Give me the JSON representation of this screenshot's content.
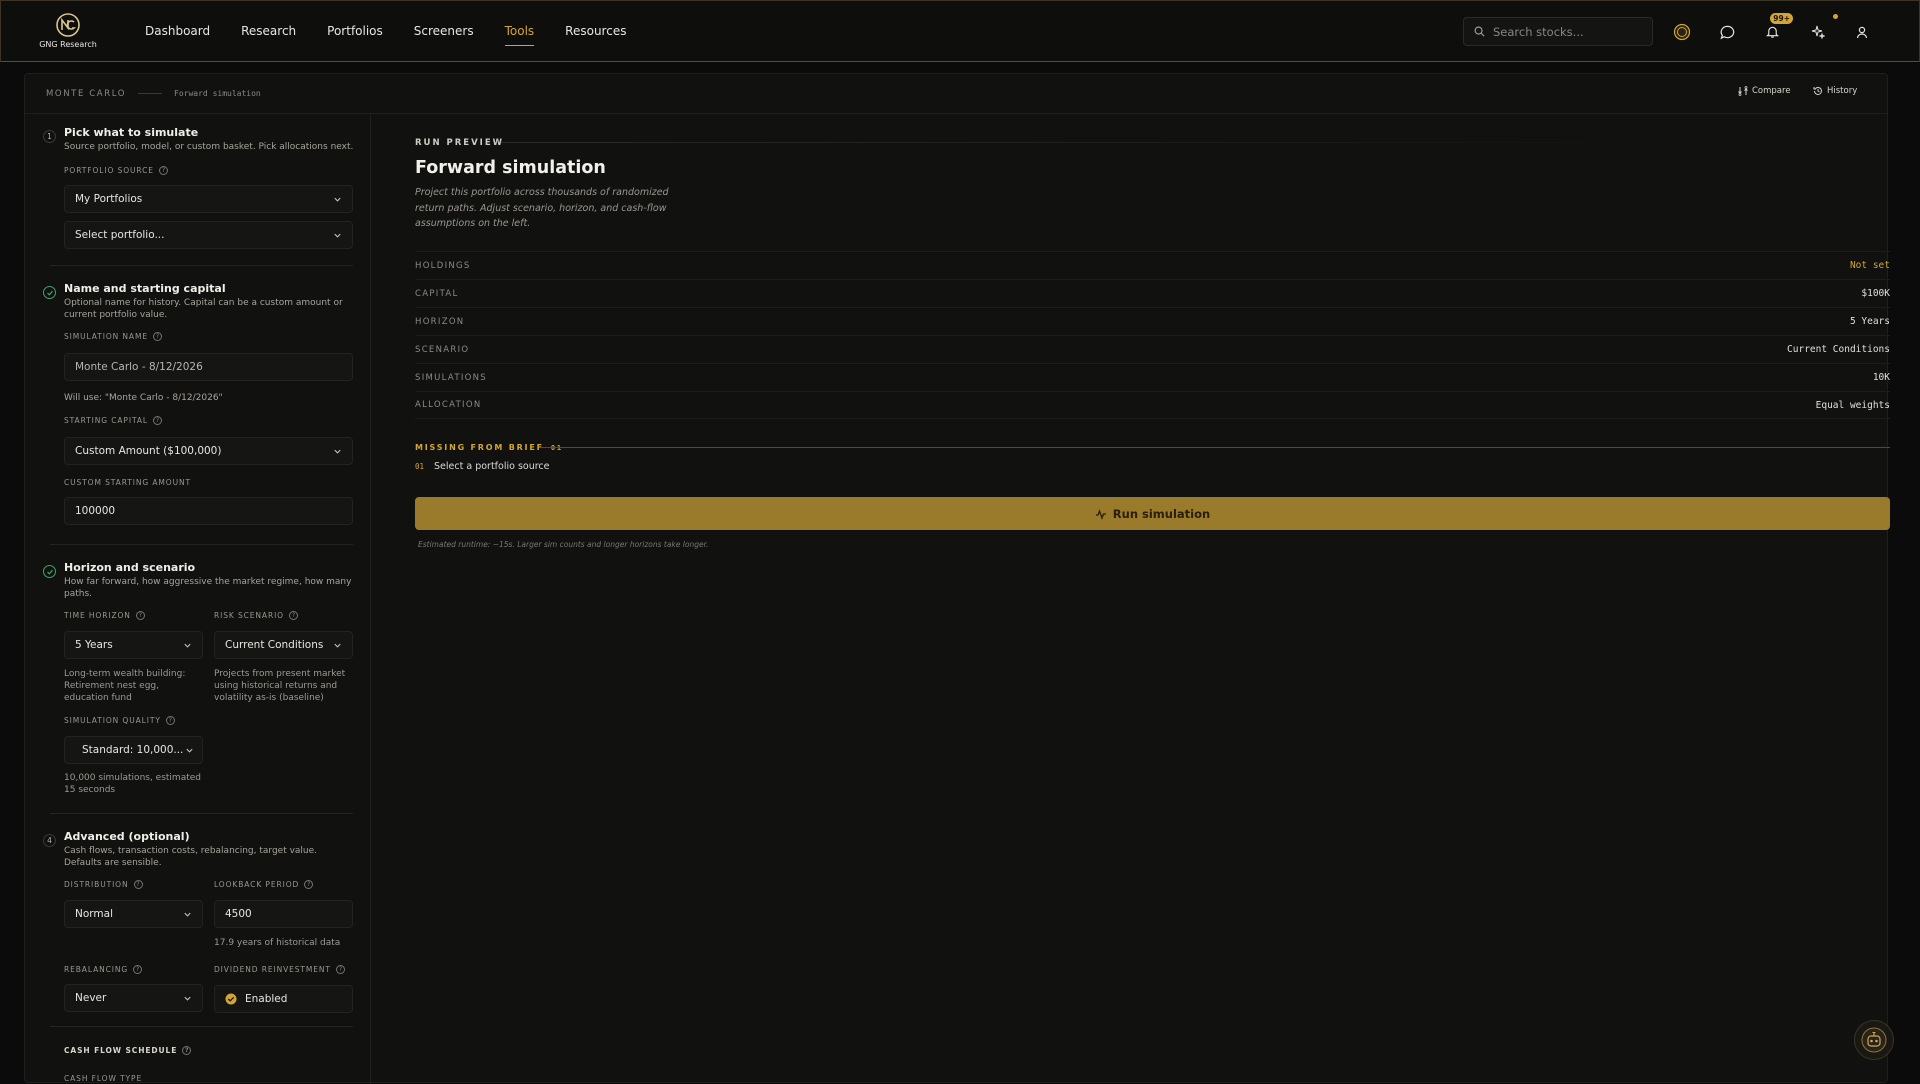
{
  "brand": {
    "name": "GNG Research"
  },
  "nav": {
    "items": [
      {
        "label": "Dashboard"
      },
      {
        "label": "Research"
      },
      {
        "label": "Portfolios"
      },
      {
        "label": "Screeners"
      },
      {
        "label": "Tools",
        "active": true
      },
      {
        "label": "Resources"
      }
    ]
  },
  "search": {
    "placeholder": "Search stocks..."
  },
  "notifications": {
    "badge": "99+"
  },
  "colors": {
    "accent": "#d4a535",
    "success": "#3fa56b",
    "background": "#0b0b0b",
    "panel": "#111110",
    "run_button": "#9a7a2b"
  },
  "breadcrumb": {
    "section": "MONTE CARLO",
    "page": "Forward simulation"
  },
  "header_actions": {
    "compare": "Compare",
    "history": "History"
  },
  "steps": {
    "s1": {
      "number": "1",
      "title": "Pick what to simulate",
      "desc": "Source portfolio, model, or custom basket. Pick allocations next.",
      "portfolio_source_label": "PORTFOLIO SOURCE",
      "portfolio_source_value": "My Portfolios",
      "portfolio_select_value": "Select portfolio..."
    },
    "s2": {
      "title": "Name and starting capital",
      "desc": "Optional name for history. Capital can be a custom amount or current portfolio value.",
      "sim_name_label": "SIMULATION NAME",
      "sim_name_placeholder": "Monte Carlo - 8/12/2026",
      "will_use": "Will use: \"Monte Carlo - 8/12/2026\"",
      "starting_capital_label": "STARTING CAPITAL",
      "starting_capital_value": "Custom Amount ($100,000)",
      "custom_amount_label": "CUSTOM STARTING AMOUNT",
      "custom_amount_value": "100000"
    },
    "s3": {
      "title": "Horizon and scenario",
      "desc": "How far forward, how aggressive the market regime, how many paths.",
      "time_horizon_label": "TIME HORIZON",
      "time_horizon_value": "5 Years",
      "time_horizon_help": "Long-term wealth building: Retirement nest egg, education fund",
      "risk_scenario_label": "RISK SCENARIO",
      "risk_scenario_value": "Current Conditions",
      "risk_scenario_help": "Projects from present market using historical returns and volatility as-is (baseline)",
      "quality_label": "SIMULATION QUALITY",
      "quality_value": "Standard: 10,000...",
      "quality_help": "10,000 simulations, estimated 15 seconds"
    },
    "s4": {
      "number": "4",
      "title": "Advanced (optional)",
      "desc": "Cash flows, transaction costs, rebalancing, target value. Defaults are sensible.",
      "distribution_label": "DISTRIBUTION",
      "distribution_value": "Normal",
      "lookback_label": "LOOKBACK PERIOD",
      "lookback_value": "4500",
      "lookback_help": "17.9 years of historical data",
      "rebalancing_label": "REBALANCING",
      "rebalancing_value": "Never",
      "dividend_label": "DIVIDEND REINVESTMENT",
      "dividend_value": "Enabled",
      "cashflow_schedule_label": "CASH FLOW SCHEDULE",
      "cashflow_type_label": "CASH FLOW TYPE"
    }
  },
  "preview": {
    "label": "RUN PREVIEW",
    "title": "Forward simulation",
    "desc": "Project this portfolio across thousands of randomized return paths. Adjust scenario, horizon, and cash-flow assumptions on the left.",
    "rows": [
      {
        "key": "HOLDINGS",
        "value": "Not set",
        "warn": true
      },
      {
        "key": "CAPITAL",
        "value": "$100K"
      },
      {
        "key": "HORIZON",
        "value": "5 Years"
      },
      {
        "key": "SCENARIO",
        "value": "Current Conditions"
      },
      {
        "key": "SIMULATIONS",
        "value": "10K"
      },
      {
        "key": "ALLOCATION",
        "value": "Equal weights"
      }
    ],
    "missing_label": "MISSING FROM BRIEF",
    "missing_count": "01",
    "missing_items": [
      {
        "n": "01",
        "text": "Select a portfolio source"
      }
    ],
    "run_button": "Run simulation",
    "runtime_note": "Estimated runtime: ~15s. Larger sim counts and longer horizons take longer."
  }
}
